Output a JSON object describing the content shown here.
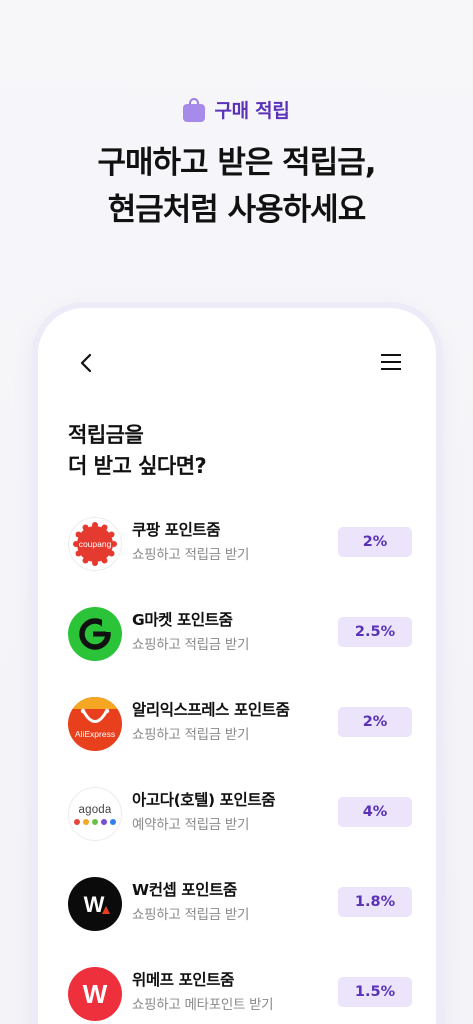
{
  "hero": {
    "badge_icon": "shopping-bag-icon",
    "badge_label": "구매 적립",
    "headline_line1": "구매하고 받은 적립금,",
    "headline_line2": "현금처럼 사용하세요",
    "accent_color": "#5a32b8"
  },
  "app": {
    "back_icon": "chevron-left-icon",
    "menu_icon": "hamburger-menu-icon",
    "title_line1": "적립금을",
    "title_line2": "더 받고 싶다면?",
    "items": [
      {
        "name": "쿠팡 포인트줌",
        "sub": "쇼핑하고 적립금 받기",
        "rate": "2%",
        "logo_text": "coupang",
        "logo_icon": "coupang-logo-icon"
      },
      {
        "name": "G마켓 포인트줌",
        "sub": "쇼핑하고 적립금 받기",
        "rate": "2.5%",
        "logo_text": "G",
        "logo_icon": "gmarket-logo-icon"
      },
      {
        "name": "알리익스프레스 포인트줌",
        "sub": "쇼핑하고 적립금 받기",
        "rate": "2%",
        "logo_text": "AliExpress",
        "logo_icon": "aliexpress-logo-icon"
      },
      {
        "name": "아고다(호텔) 포인트줌",
        "sub": "예약하고 적립금 받기",
        "rate": "4%",
        "logo_text": "agoda",
        "logo_icon": "agoda-logo-icon"
      },
      {
        "name": "W컨셉 포인트줌",
        "sub": "쇼핑하고 적립금 받기",
        "rate": "1.8%",
        "logo_text": "W",
        "logo_icon": "wconcept-logo-icon"
      },
      {
        "name": "위메프 포인트줌",
        "sub": "쇼핑하고 메타포인트 받기",
        "rate": "1.5%",
        "logo_text": "W",
        "logo_icon": "wemakeprice-logo-icon"
      }
    ]
  }
}
